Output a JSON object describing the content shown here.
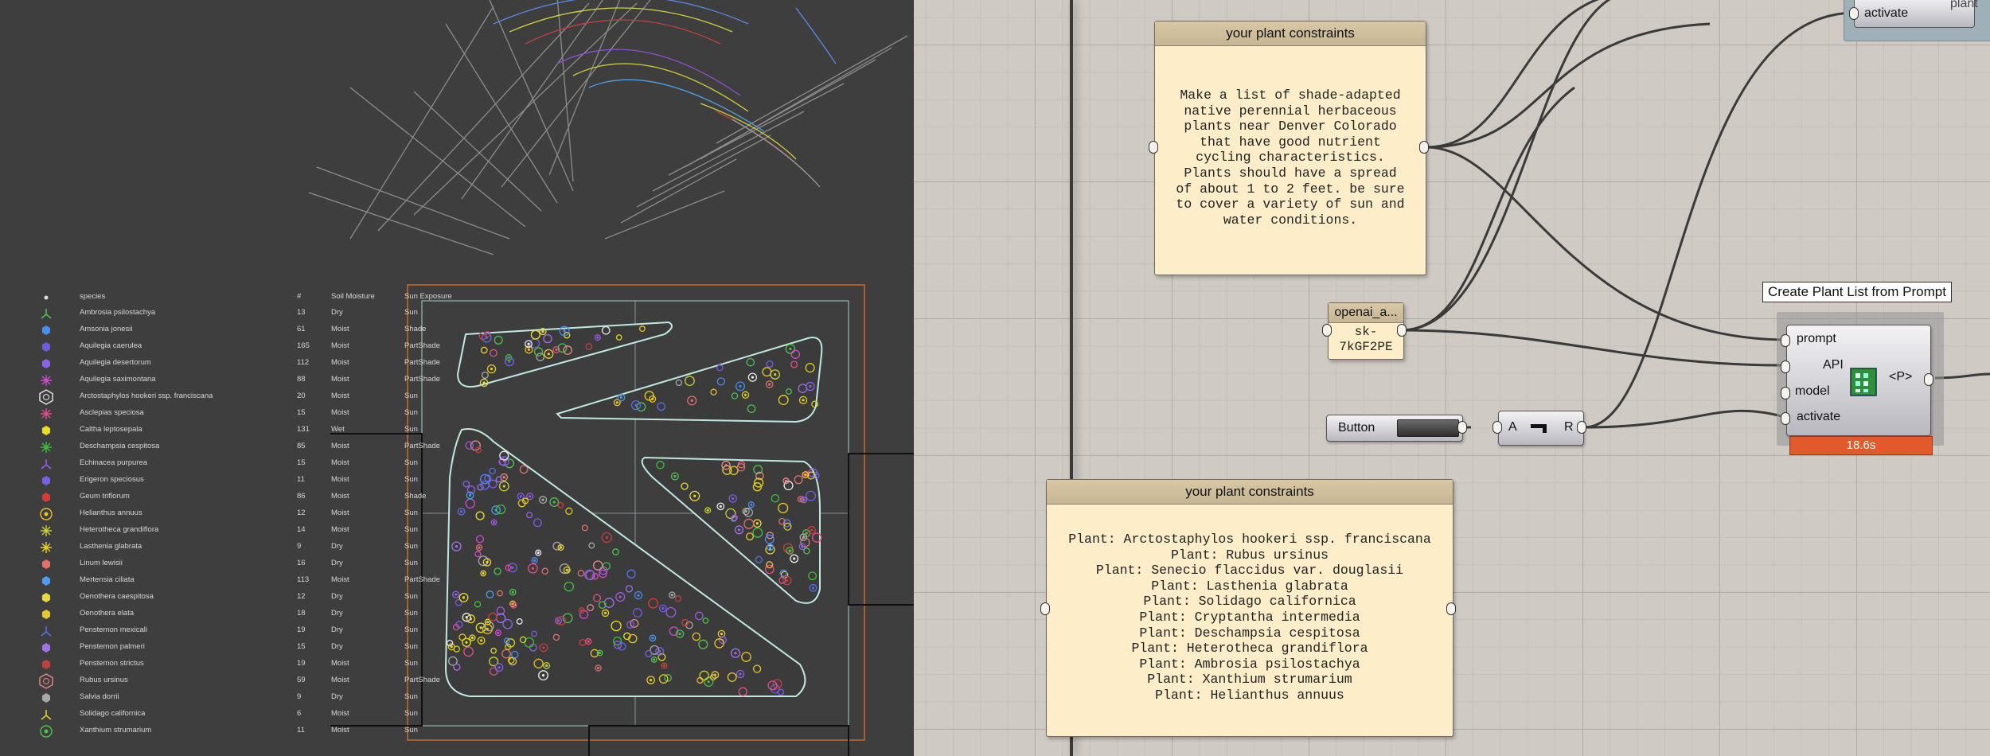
{
  "table": {
    "headers": {
      "species": "species",
      "num": "#",
      "moisture": "Soil Moisture",
      "sun": "Sun Exposure"
    },
    "rows": [
      {
        "species": "Ambrosia psilostachya",
        "num": "13",
        "moisture": "Dry",
        "sun": "Sun",
        "color": "#4fbf4f"
      },
      {
        "species": "Amsonia jonesii",
        "num": "61",
        "moisture": "Moist",
        "sun": "Shade",
        "color": "#4a8cf0"
      },
      {
        "species": "Aquilegia caerulea",
        "num": "165",
        "moisture": "Moist",
        "sun": "PartShade",
        "color": "#6f5ce0"
      },
      {
        "species": "Aquilegia desertorum",
        "num": "112",
        "moisture": "Moist",
        "sun": "PartShade",
        "color": "#8a63e8"
      },
      {
        "species": "Aquilegia saximontana",
        "num": "88",
        "moisture": "Moist",
        "sun": "PartShade",
        "color": "#d04ad0"
      },
      {
        "species": "Arctostaphylos hookeri ssp. franciscana",
        "num": "20",
        "moisture": "Moist",
        "sun": "Sun",
        "color": "#e8e8e8"
      },
      {
        "species": "Asclepias speciosa",
        "num": "15",
        "moisture": "Moist",
        "sun": "Sun",
        "color": "#e0508a"
      },
      {
        "species": "Caltha leptosepala",
        "num": "131",
        "moisture": "Wet",
        "sun": "Sun",
        "color": "#e8e020"
      },
      {
        "species": "Deschampsia cespitosa",
        "num": "85",
        "moisture": "Moist",
        "sun": "PartShade",
        "color": "#3cbf3c"
      },
      {
        "species": "Echinacea purpurea",
        "num": "15",
        "moisture": "Moist",
        "sun": "Sun",
        "color": "#9c5ae0"
      },
      {
        "species": "Erigeron speciosus",
        "num": "11",
        "moisture": "Moist",
        "sun": "Sun",
        "color": "#7b5ee8"
      },
      {
        "species": "Geum triflorum",
        "num": "86",
        "moisture": "Moist",
        "sun": "Shade",
        "color": "#d83a3a"
      },
      {
        "species": "Helianthus annuus",
        "num": "12",
        "moisture": "Moist",
        "sun": "Sun",
        "color": "#e8c020"
      },
      {
        "species": "Heterotheca grandiflora",
        "num": "14",
        "moisture": "Moist",
        "sun": "Sun",
        "color": "#c8d030"
      },
      {
        "species": "Lasthenia glabrata",
        "num": "9",
        "moisture": "Dry",
        "sun": "Sun",
        "color": "#e8d020"
      },
      {
        "species": "Linum lewisii",
        "num": "16",
        "moisture": "Dry",
        "sun": "Sun",
        "color": "#e07070"
      },
      {
        "species": "Mertensia ciliata",
        "num": "113",
        "moisture": "Moist",
        "sun": "PartShade",
        "color": "#4a9cf0"
      },
      {
        "species": "Oenothera caespitosa",
        "num": "12",
        "moisture": "Dry",
        "sun": "Sun",
        "color": "#e8d840"
      },
      {
        "species": "Oenothera elata",
        "num": "18",
        "moisture": "Dry",
        "sun": "Sun",
        "color": "#e8c830"
      },
      {
        "species": "Penstemon mexicali",
        "num": "19",
        "moisture": "Dry",
        "sun": "Sun",
        "color": "#5a6ee8"
      },
      {
        "species": "Penstemon palmeri",
        "num": "15",
        "moisture": "Dry",
        "sun": "Sun",
        "color": "#a070e8"
      },
      {
        "species": "Penstemon strictus",
        "num": "19",
        "moisture": "Moist",
        "sun": "Sun",
        "color": "#c04040"
      },
      {
        "species": "Rubus ursinus",
        "num": "59",
        "moisture": "Moist",
        "sun": "PartShade",
        "color": "#e88a8a"
      },
      {
        "species": "Salvia dorrii",
        "num": "9",
        "moisture": "Dry",
        "sun": "Sun",
        "color": "#a8a8a8"
      },
      {
        "species": "Solidago californica",
        "num": "6",
        "moisture": "Moist",
        "sun": "Sun",
        "color": "#e0d020"
      },
      {
        "species": "Xanthium strumarium",
        "num": "11",
        "moisture": "Moist",
        "sun": "Sun",
        "color": "#50c050"
      }
    ]
  },
  "canvas": {
    "prompt_panel": {
      "title": "your plant constraints",
      "text": "Make a list of shade-adapted\nnative perennial herbaceous\nplants near Denver Colorado\nthat have good nutrient\ncycling characteristics.\nPlants should have a spread\nof about 1 to 2 feet. be sure\nto cover a variety of sun and\nwater conditions."
    },
    "api_panel": {
      "title": "openai_a...",
      "text": "sk-\n7kGF2PE"
    },
    "button": {
      "label": "Button"
    },
    "toggle": {
      "left": "A",
      "right": "R"
    },
    "component": {
      "tooltip": "Create Plant List from Prompt",
      "inputs": [
        "prompt",
        "API",
        "model",
        "activate"
      ],
      "output": "<P>",
      "timer": "18.6s"
    },
    "top_right": {
      "activate": "activate",
      "plant": "plant"
    },
    "output_panel": {
      "title": "your plant constraints",
      "text": "Plant: Arctostaphylos hookeri ssp. franciscana\nPlant: Rubus ursinus\nPlant: Senecio flaccidus var. douglasii\nPlant: Lasthenia glabrata\nPlant: Solidago californica\nPlant: Cryptantha intermedia\nPlant: Deschampsia cespitosa\nPlant: Heterotheca grandiflora\nPlant: Ambrosia psilostachya\nPlant: Xanthium strumarium\nPlant: Helianthus annuus"
    }
  },
  "colors": {
    "timer_bar": "#e05a2c",
    "panel_bg": "#fdedc8",
    "canvas_bg": "#cfcbc4",
    "viewport_bg": "#3e3e3e"
  }
}
